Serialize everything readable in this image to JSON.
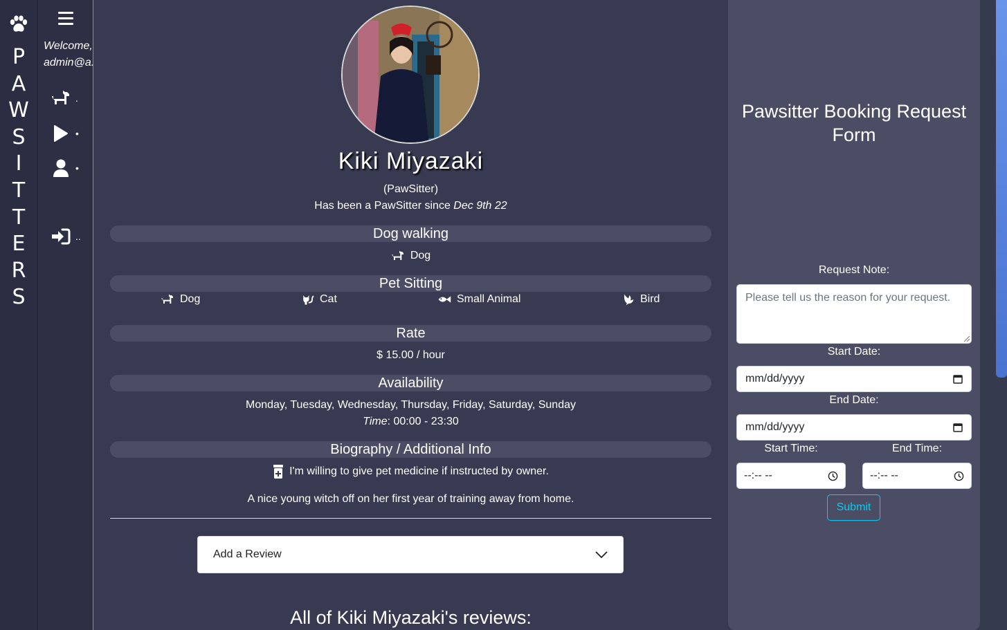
{
  "brand": {
    "letters": [
      "P",
      "A",
      "W",
      "S",
      "I",
      "T",
      "T",
      "E",
      "R",
      "S"
    ],
    "icon": "paw-icon"
  },
  "nav": {
    "welcome_line1": "Welcome,",
    "welcome_line2": "admin@a...",
    "items": [
      {
        "icon": "dog-icon",
        "label": "."
      },
      {
        "icon": "play-icon",
        "label": "•"
      },
      {
        "icon": "user-icon",
        "label": "•"
      },
      {
        "icon": "sign-in-icon",
        "label": ".."
      }
    ]
  },
  "profile": {
    "name": "Kiki Miyazaki",
    "role": "(PawSitter)",
    "since_prefix": "Has been a PawSitter since ",
    "since_date": "Dec 9th 22",
    "sections": {
      "dog_walking": {
        "title": "Dog walking",
        "pets": [
          "Dog"
        ]
      },
      "pet_sitting": {
        "title": "Pet Sitting",
        "pets": [
          "Dog",
          "Cat",
          "Small Animal",
          "Bird"
        ]
      },
      "rate": {
        "title": "Rate",
        "value": "$ 15.00 / hour"
      },
      "availability": {
        "title": "Availability",
        "days": "Monday, Tuesday, Wednesday, Thursday, Friday, Saturday, Sunday",
        "time_label": "Time",
        "time_value": ": 00:00 - 23:30"
      },
      "bio": {
        "title": "Biography / Additional Info",
        "medicine": "I'm willing to give pet medicine if instructed by owner.",
        "text": "A nice young witch off on her first year of training away from home."
      }
    },
    "review_dropdown": "Add a Review",
    "reviews_title": "All of Kiki Miyazaki's reviews:"
  },
  "booking": {
    "title_line1": "Pawsitter Booking Request",
    "title_line2": "Form",
    "note_label": "Request Note:",
    "note_placeholder": "Please tell us the reason for your request.",
    "start_date_label": "Start Date:",
    "start_date_value": "mm/dd/yyyy",
    "end_date_label": "End Date:",
    "end_date_value": "mm/dd/yyyy",
    "start_time_label": "Start Time:",
    "start_time_value": "--:-- --",
    "end_time_label": "End Time:",
    "end_time_value": "--:-- --",
    "submit_label": "Submit"
  },
  "colors": {
    "page_bg": "#363a4f",
    "panel_bg": "#4a4d63",
    "submit_accent": "#0dcaf0",
    "scrollbar": "#5a82e0"
  }
}
